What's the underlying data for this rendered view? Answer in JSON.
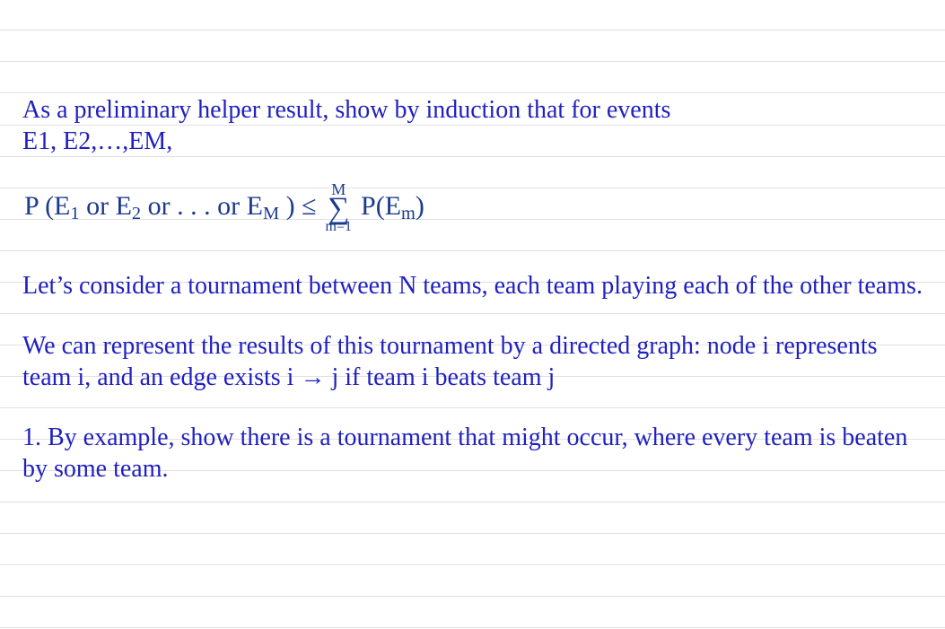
{
  "para1_a": "As a preliminary helper result, show by induction that for events",
  "para1_b": "E1, E2,…,EM,",
  "formula": {
    "lhs_prefix": "P (E",
    "sub1": "1",
    "or1": " or E",
    "sub2": "2",
    "or_dots": " or . . . or E",
    "subM": "M",
    "close_le": " ) ≤ ",
    "sigma_top": "M",
    "sigma_sym": "∑",
    "sigma_bot": "m=1",
    "rhs_prefix": " P(E",
    "rhs_sub": "m",
    "rhs_close": ")"
  },
  "para2": "Let’s consider a tournament between N teams, each team playing each of the other teams.",
  "para3": "We can represent the results of this tournament by a directed graph: node i represents team i, and an edge exists i → j if team i beats team j",
  "para4": "1. By example, show there is a tournament that might occur, where every team is beaten by some team."
}
